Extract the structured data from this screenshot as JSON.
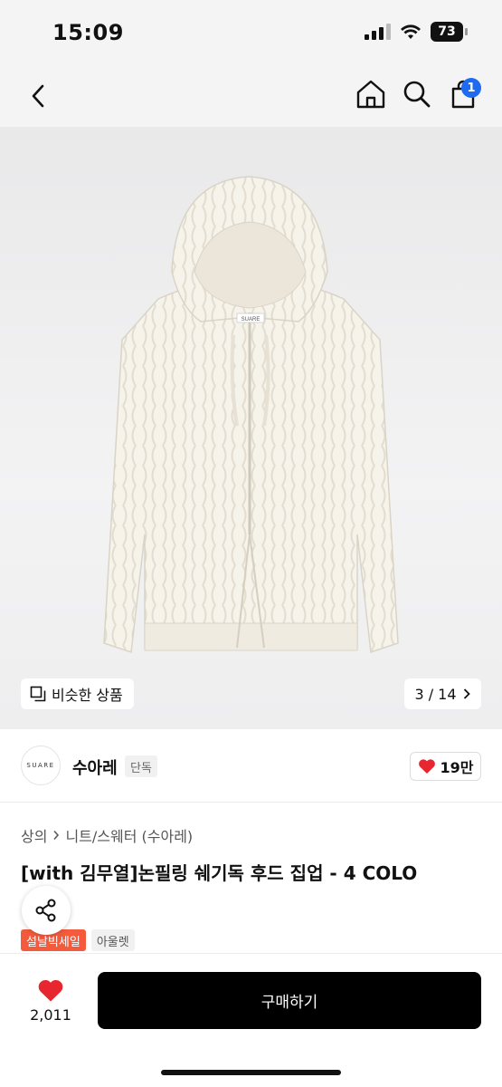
{
  "status_bar": {
    "time": "15:09",
    "battery": "73"
  },
  "nav": {
    "cart_count": "1",
    "icons": [
      "back-icon",
      "home-icon",
      "search-icon",
      "cart-icon"
    ]
  },
  "gallery": {
    "similar_label": "비슷한 상품",
    "page_indicator": "3 / 14"
  },
  "brand": {
    "logo_text": "SUARE",
    "name": "수아레",
    "exclusive_tag": "단독",
    "like_count": "19만"
  },
  "product": {
    "breadcrumb": [
      "상의",
      "니트/스웨터 (수아레)"
    ],
    "title": "[with 김무열]논필링 쉐기독 후드 집업 - 4 COLO",
    "garment_label": "SUARE",
    "tags": [
      "설날빅세일",
      "아울렛"
    ]
  },
  "bottom": {
    "wish_count": "2,011",
    "buy_label": "구매하기"
  },
  "colors": {
    "badge_blue": "#1e6bf1",
    "heart_red": "#e8262f",
    "sale_tag": "#f35b3c",
    "buy_button": "#000000"
  }
}
